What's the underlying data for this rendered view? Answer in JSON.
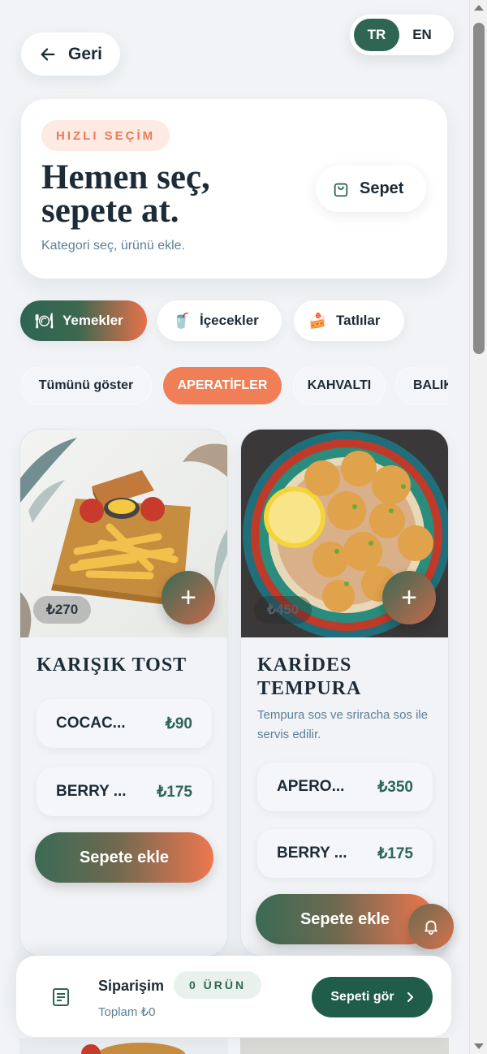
{
  "header": {
    "back_label": "Geri",
    "languages": [
      {
        "code": "TR",
        "active": true
      },
      {
        "code": "EN",
        "active": false
      }
    ]
  },
  "hero": {
    "badge": "HIZLI SEÇİM",
    "title_line1": "Hemen seç,",
    "title_line2": "sepete at.",
    "subtitle": "Kategori seç, ürünü ekle.",
    "cart_label": "Sepet"
  },
  "categories": [
    {
      "label": "Yemekler",
      "icon": "plate-icon",
      "active": true
    },
    {
      "label": "İçecekler",
      "icon": "drink-icon",
      "active": false
    },
    {
      "label": "Tatlılar",
      "icon": "cake-icon",
      "active": false
    }
  ],
  "subcategories": [
    {
      "label": "Tümünü göster",
      "active": false
    },
    {
      "label": "APERATİFLER",
      "active": true
    },
    {
      "label": "KAHVALTI",
      "active": false
    },
    {
      "label": "BALIK",
      "active": false
    }
  ],
  "products": [
    {
      "title": "KARIŞIK TOST",
      "price": "₺270",
      "description": "",
      "options": [
        {
          "name": "COCAC...",
          "price": "₺90"
        },
        {
          "name": "BERRY ...",
          "price": "₺175"
        }
      ],
      "cta": "Sepete ekle"
    },
    {
      "title": "KARİDES TEMPURA",
      "price": "₺450",
      "description": "Tempura sos ve sriracha sos ile servis edilir.",
      "options": [
        {
          "name": "APERO...",
          "price": "₺350"
        },
        {
          "name": "BERRY ...",
          "price": "₺175"
        }
      ],
      "cta": "Sepete ekle"
    }
  ],
  "order_bar": {
    "title": "Siparişim",
    "badge": "0 ÜRÜN",
    "total": "Toplam ₺0",
    "view_cart": "Sepeti gör"
  },
  "colors": {
    "primary_green": "#2e6653",
    "accent_orange": "#f07f57",
    "background": "#f1f3f6"
  }
}
